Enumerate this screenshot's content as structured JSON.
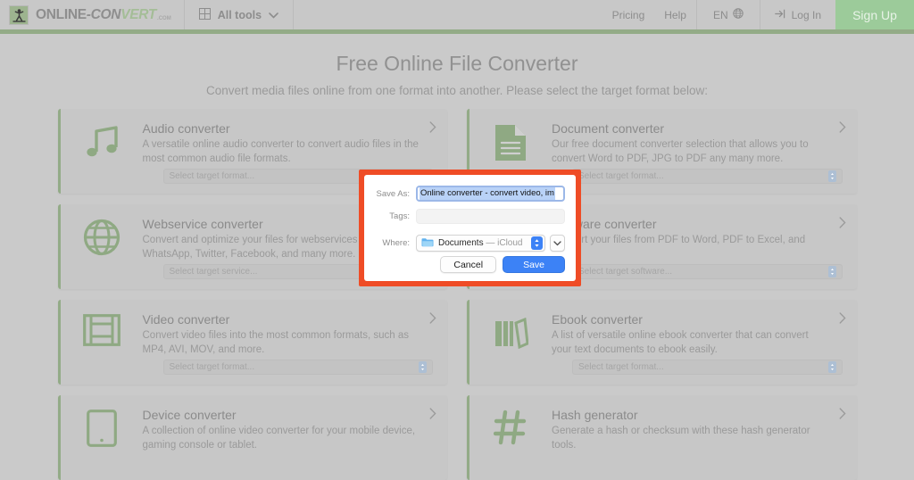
{
  "header": {
    "logo": {
      "icon": "person-figure-icon",
      "part1": "ONLINE",
      "dash": "-",
      "part2": "CON",
      "part3": "VERT",
      "dotcom": ".COM"
    },
    "all_tools_label": "All tools",
    "pricing_label": "Pricing",
    "help_label": "Help",
    "language_label": "EN",
    "login_label": "Log In",
    "signup_label": "Sign Up",
    "accent_green": "#93ab87",
    "signup_bg": "#9ccb9a"
  },
  "main": {
    "title": "Free Online File Converter",
    "subtitle": "Convert media files online from one format into another. Please select the target format below:"
  },
  "cards": [
    {
      "icon": "music-note-icon",
      "title": "Audio converter",
      "desc": "A versatile online audio converter to convert audio files in the most common audio file formats.",
      "select_placeholder": "Select target format...",
      "has_select": true
    },
    {
      "icon": "document-icon",
      "title": "Document converter",
      "desc": "Our free document converter selection that allows you to convert Word to PDF, JPG to PDF any many more.",
      "select_placeholder": "Select target format...",
      "has_select": true
    },
    {
      "icon": "globe-icon",
      "title": "Webservice converter",
      "desc": "Convert and optimize your files for webservices like WhatsApp, Twitter, Facebook, and many more.",
      "select_placeholder": "Select target service...",
      "has_select": true
    },
    {
      "icon": "software-box-icon",
      "title": "Software converter",
      "desc": "Convert your files from PDF to Word, PDF to Excel, and more.",
      "select_placeholder": "Select target software...",
      "has_select": true
    },
    {
      "icon": "film-strip-icon",
      "title": "Video converter",
      "desc": "Convert video files into the most common formats, such as MP4, AVI, MOV, and more.",
      "select_placeholder": "Select target format...",
      "has_select": true
    },
    {
      "icon": "books-icon",
      "title": "Ebook converter",
      "desc": "A list of versatile online ebook converter that can convert your text documents to ebook easily.",
      "select_placeholder": "Select target format...",
      "has_select": true
    },
    {
      "icon": "tablet-device-icon",
      "title": "Device converter",
      "desc": "A collection of online video converter for your mobile device, gaming console or tablet.",
      "select_placeholder": "",
      "has_select": false
    },
    {
      "icon": "hash-icon",
      "title": "Hash generator",
      "desc": "Generate a hash or checksum with these hash generator tools.",
      "select_placeholder": "",
      "has_select": false
    }
  ],
  "save_dialog": {
    "highlight_color": "#ef4c26",
    "save_as_label": "Save As:",
    "save_as_value": "Online converter - convert video, im",
    "tags_label": "Tags:",
    "tags_value": "",
    "where_label": "Where:",
    "where_value": "Documents",
    "where_value_suffix": " — iCloud",
    "cancel_label": "Cancel",
    "save_label": "Save",
    "save_button_color": "#3c82f6"
  }
}
